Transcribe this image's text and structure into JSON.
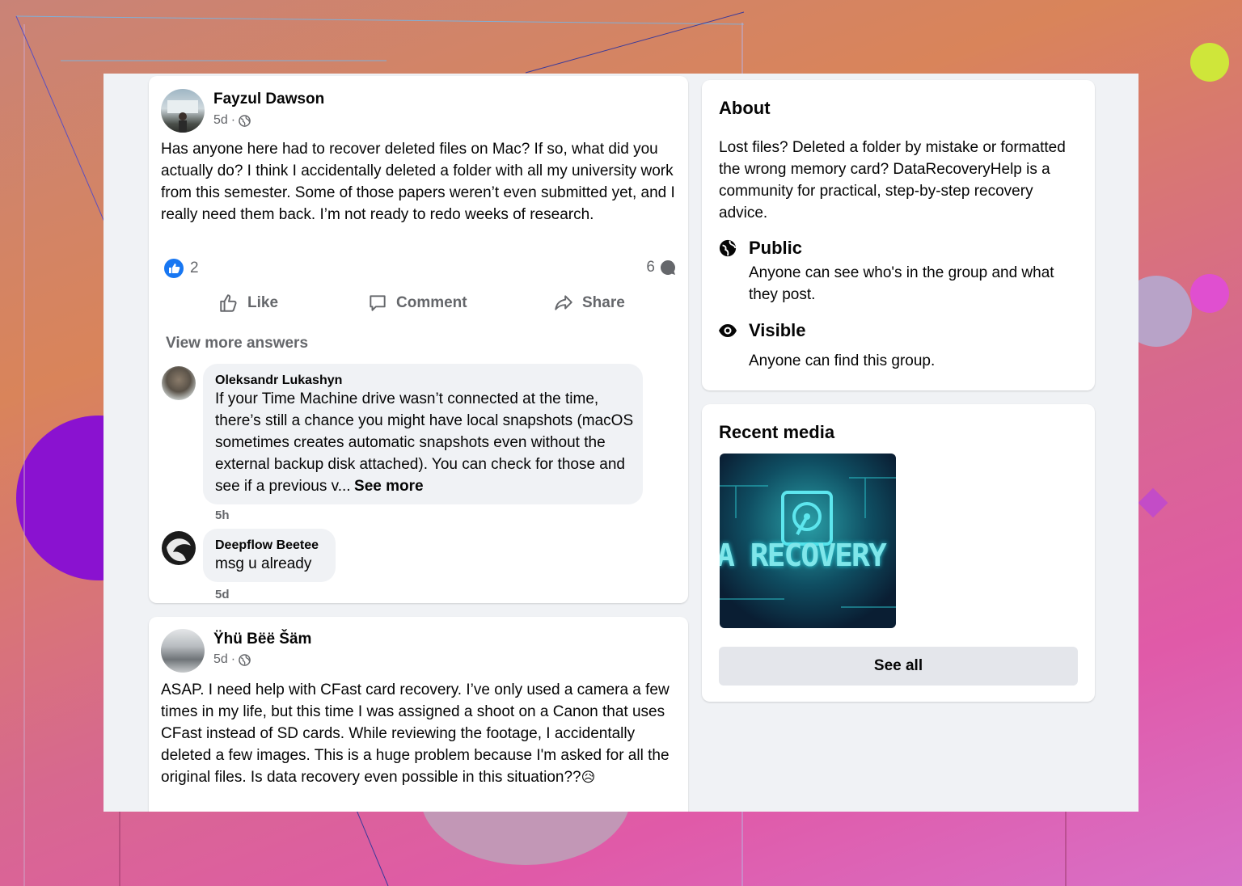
{
  "posts": [
    {
      "author": "Fayzul Dawson",
      "time": "5d",
      "text": "Has anyone here had to recover deleted files on Mac? If so, what did you actually do? I think I accidentally deleted a folder with all my university work from this semester. Some of those papers weren’t even submitted yet, and I really need them back. I’m not ready to redo weeks of research.",
      "reactions": "2",
      "comments_count": "6",
      "actions": {
        "like": "Like",
        "comment": "Comment",
        "share": "Share"
      },
      "view_more": "View more answers",
      "comments": [
        {
          "author": "Oleksandr Lukashyn",
          "text": "If your Time Machine drive wasn’t connected at the time, there’s still a chance you might have local snapshots (macOS sometimes creates automatic snapshots even without the external backup disk attached). You can check for those and see if a previous v...",
          "see_more": "See more",
          "time": "5h"
        },
        {
          "author": "Deepflow Beetee",
          "text": "msg u already",
          "time": "5d"
        }
      ]
    },
    {
      "author": "Ÿhü Bëë Šäm",
      "time": "5d",
      "text": "ASAP. I need help with CFast card recovery. I’ve only used a camera a few times in my life, but this time I was assigned a shoot on a Canon that uses CFast instead of SD cards. While reviewing the footage, I accidentally deleted a few images. This is a huge problem because I'm asked for all the original files. Is data recovery even possible in this situation??",
      "emoji": "😥"
    }
  ],
  "about": {
    "title": "About",
    "description": "Lost files? Deleted a folder by mistake or formatted the wrong memory card? DataRecoveryHelp is a community for practical, step-by-step recovery advice.",
    "public_title": "Public",
    "public_desc": "Anyone can see who's in the group and what they post.",
    "visible_title": "Visible",
    "visible_desc": "Anyone can find this group."
  },
  "recent_media": {
    "title": "Recent media",
    "thumb_text": "A RECOVERY H",
    "see_all": "See all"
  },
  "colors": {
    "like_blue": "#1877f2",
    "panel_bg": "#f0f2f5",
    "text": "#050505",
    "muted": "#65676b"
  }
}
